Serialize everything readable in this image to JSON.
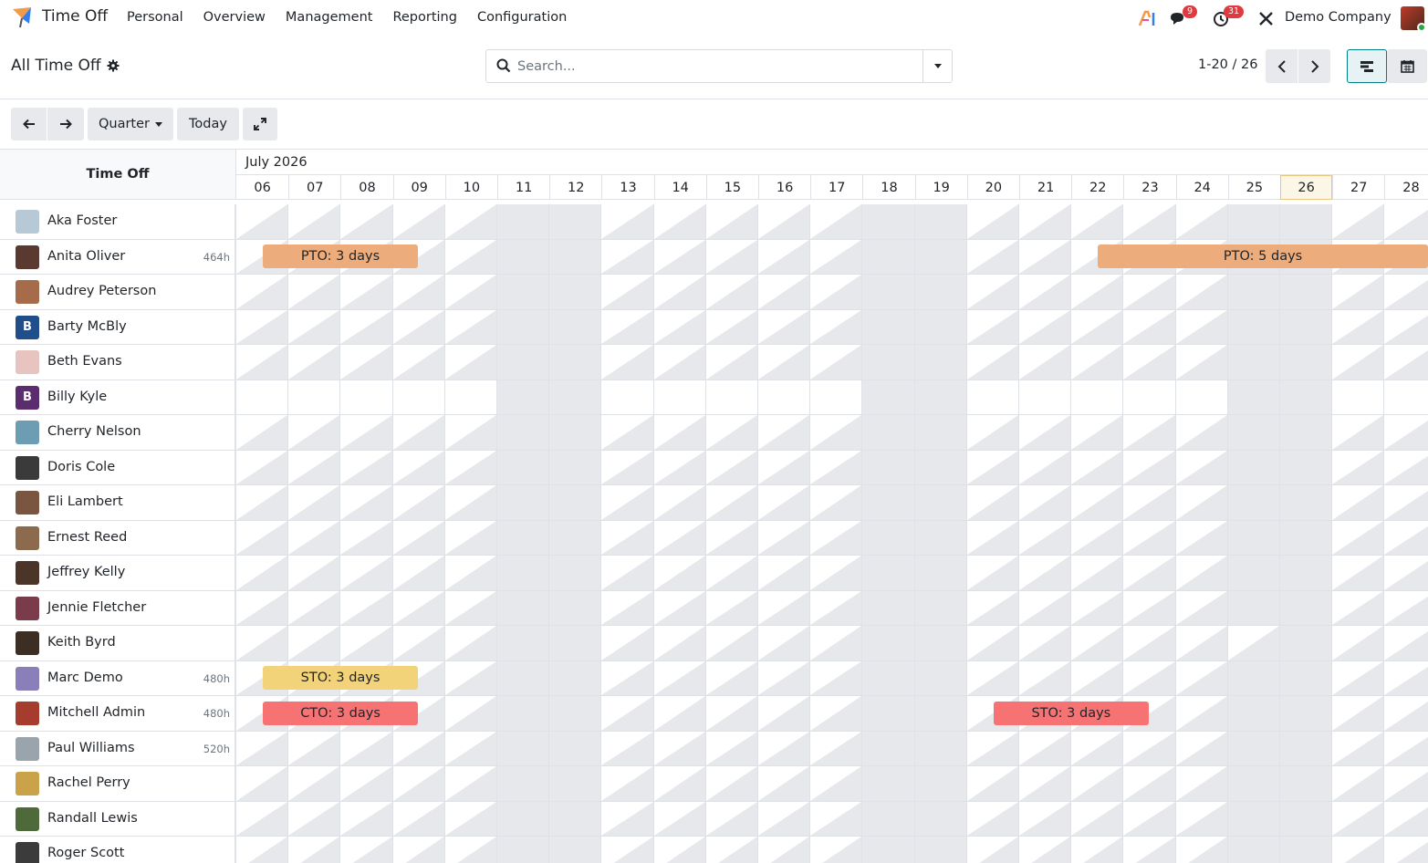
{
  "app": {
    "name": "Time Off"
  },
  "menu": [
    "Personal",
    "Overview",
    "Management",
    "Reporting",
    "Configuration"
  ],
  "systray": {
    "messages_count": "9",
    "activities_count": "31",
    "company": "Demo Company"
  },
  "control": {
    "title": "All Time Off",
    "search_placeholder": "Search...",
    "pager": "1-20 / 26"
  },
  "toolbar": {
    "scale_label": "Quarter",
    "today_label": "Today"
  },
  "gantt": {
    "header_label": "Time Off",
    "month": "July 2026",
    "days": [
      "06",
      "07",
      "08",
      "09",
      "10",
      "11",
      "12",
      "13",
      "14",
      "15",
      "16",
      "17",
      "18",
      "19",
      "20",
      "21",
      "22",
      "23",
      "24",
      "25",
      "26",
      "27",
      "28"
    ],
    "today": "26",
    "rows": [
      {
        "name": "Aka Foster",
        "hours": "",
        "initial": "",
        "color": "#b7c9d6"
      },
      {
        "name": "Anita Oliver",
        "hours": "464h",
        "initial": "",
        "color": "#5a3a30"
      },
      {
        "name": "Audrey Peterson",
        "hours": "",
        "initial": "",
        "color": "#a56b4a"
      },
      {
        "name": "Barty McBly",
        "hours": "",
        "initial": "B",
        "color": "#1f4e8a"
      },
      {
        "name": "Beth Evans",
        "hours": "",
        "initial": "",
        "color": "#e8c4c0"
      },
      {
        "name": "Billy Kyle",
        "hours": "",
        "initial": "B",
        "color": "#5b2d6e"
      },
      {
        "name": "Cherry Nelson",
        "hours": "",
        "initial": "",
        "color": "#6d9db3"
      },
      {
        "name": "Doris Cole",
        "hours": "",
        "initial": "",
        "color": "#3a3a3a"
      },
      {
        "name": "Eli Lambert",
        "hours": "",
        "initial": "",
        "color": "#7a5640"
      },
      {
        "name": "Ernest Reed",
        "hours": "",
        "initial": "",
        "color": "#8b6a4d"
      },
      {
        "name": "Jeffrey Kelly",
        "hours": "",
        "initial": "",
        "color": "#4a3528"
      },
      {
        "name": "Jennie Fletcher",
        "hours": "",
        "initial": "",
        "color": "#7a3b4a"
      },
      {
        "name": "Keith Byrd",
        "hours": "",
        "initial": "",
        "color": "#3d2e24"
      },
      {
        "name": "Marc Demo",
        "hours": "480h",
        "initial": "",
        "color": "#8a7fb8"
      },
      {
        "name": "Mitchell Admin",
        "hours": "480h",
        "initial": "",
        "color": "#a53c2e"
      },
      {
        "name": "Paul Williams",
        "hours": "520h",
        "initial": "",
        "color": "#9aa4ad"
      },
      {
        "name": "Rachel Perry",
        "hours": "",
        "initial": "",
        "color": "#c9a24a"
      },
      {
        "name": "Randall Lewis",
        "hours": "",
        "initial": "",
        "color": "#4f6a3a"
      },
      {
        "name": "Roger Scott",
        "hours": "",
        "initial": "",
        "color": "#3b3b3b"
      }
    ],
    "pills": [
      {
        "row": 1,
        "start": 0,
        "span": 3,
        "label": "PTO: 3 days",
        "color": "#edac7b"
      },
      {
        "row": 1,
        "start": 16,
        "span": 7,
        "label": "PTO: 5 days",
        "color": "#edac7b"
      },
      {
        "row": 13,
        "start": 0,
        "span": 3,
        "label": "STO: 3 days",
        "color": "#f3d379"
      },
      {
        "row": 14,
        "start": 0,
        "span": 3,
        "label": "CTO: 3 days",
        "color": "#f67273"
      },
      {
        "row": 14,
        "start": 14,
        "span": 3,
        "label": "STO: 3 days",
        "color": "#f67273"
      }
    ]
  }
}
